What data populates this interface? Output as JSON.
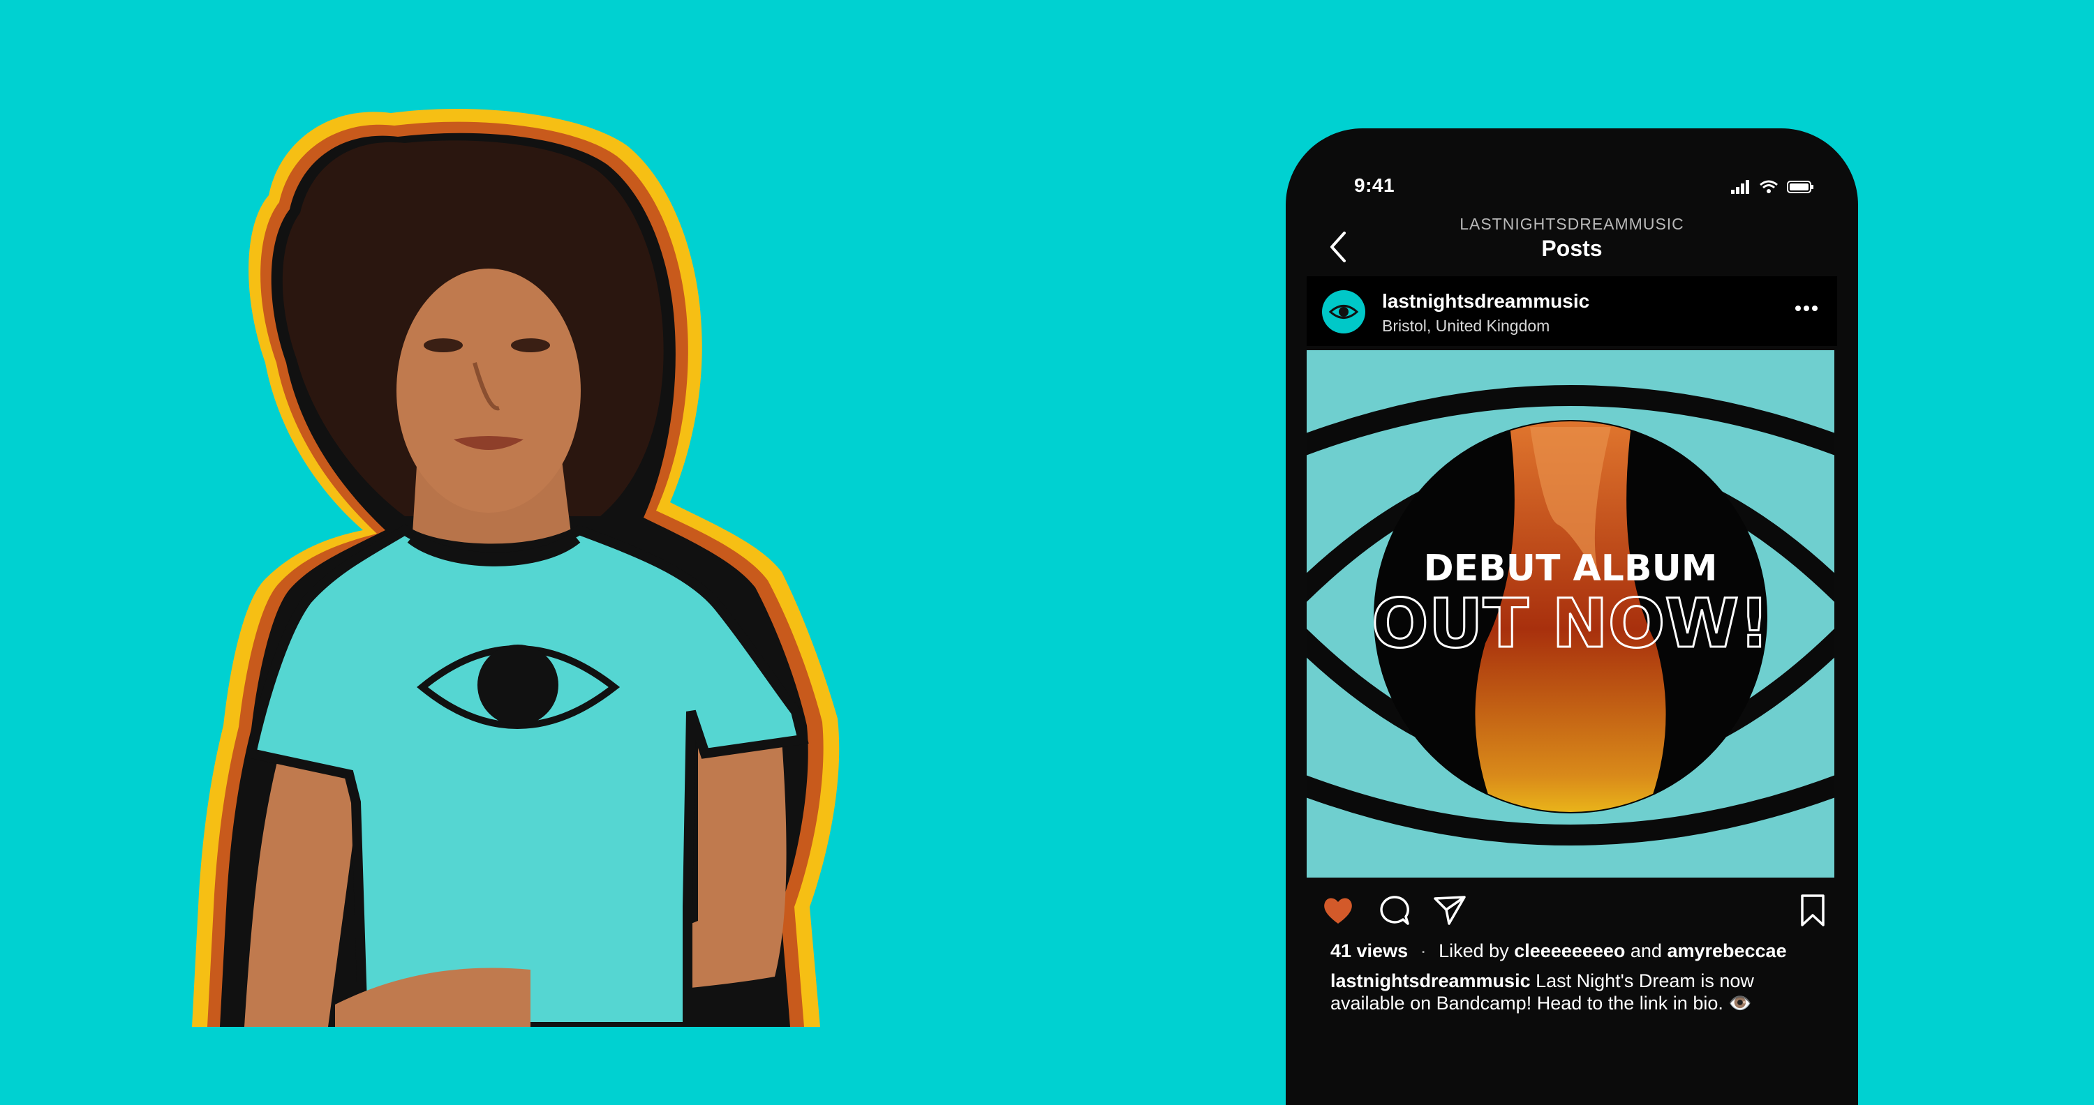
{
  "status": {
    "time": "9:41"
  },
  "nav": {
    "username": "LASTNIGHTSDREAMMUSIC",
    "title": "Posts"
  },
  "post": {
    "username": "lastnightsdreammusic",
    "location": "Bristol, United Kingdom",
    "image_text": {
      "line1": "DEBUT ALBUM",
      "line2": "OUT NOW!"
    },
    "views": "41 views",
    "separator": "·",
    "liked_by_prefix": "Liked by",
    "liked_by_user1": "cleeeeeeeeo",
    "liked_by_and": "and",
    "liked_by_user2": "amyrebeccae",
    "caption_user": "lastnightsdreammusic",
    "caption_text": "Last Night's Dream is now available on Bandcamp! Head to the link in bio. 👁️"
  },
  "colors": {
    "background": "#00d1d1",
    "phone": "#0b0b0b",
    "like": "#d35a2a",
    "art_teal": "#6fcfcf",
    "shirt": "#55d6d2"
  },
  "icons": [
    "back-chevron-icon",
    "eye-avatar-icon",
    "more-dots-icon",
    "heart-icon",
    "comment-icon",
    "share-icon",
    "bookmark-icon",
    "signal-icon",
    "wifi-icon",
    "battery-icon"
  ]
}
